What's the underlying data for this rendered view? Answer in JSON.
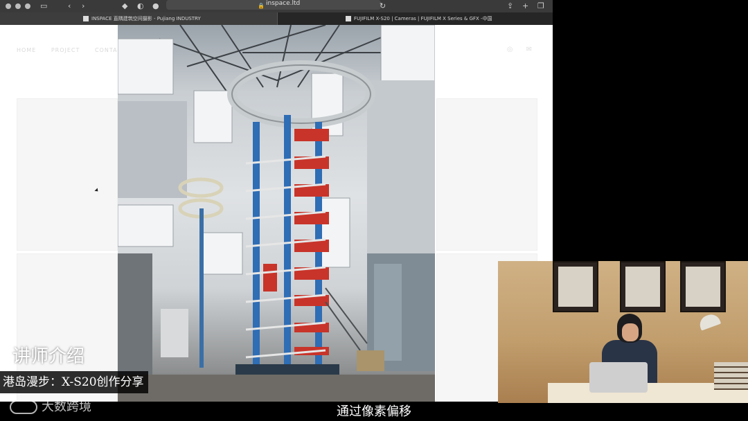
{
  "browser": {
    "url": "inspace.ltd",
    "tabs": [
      {
        "label": "INSPACE 直隅建筑空间摄影 - Pujiang INDUSTRY",
        "active": true
      },
      {
        "label": "FUJIFILM X-S20 | Cameras | FUJIFILM X Series & GFX -中国",
        "active": false
      }
    ]
  },
  "website": {
    "nav": [
      "HOME",
      "PROJECT",
      "CONTACT"
    ]
  },
  "overlay": {
    "lecturer_heading": "讲师介绍",
    "lecturer_name": "港岛漫步：X-S20创作分享",
    "logo_text": "大数跨境",
    "subtitle": "通过像素偏移"
  },
  "colors": {
    "toolbar": "#3a3a3a",
    "tabbar": "#2b2b2b",
    "caption_bg": "#000000",
    "webcam_wall": "#c29e6d"
  },
  "icons": [
    "close-dot",
    "minimize-dot",
    "zoom-dot",
    "sidebar-icon",
    "back-icon",
    "forward-icon",
    "shield-icon",
    "lock-icon",
    "reload-icon",
    "share-icon",
    "new-tab-icon",
    "tabs-overview-icon"
  ]
}
